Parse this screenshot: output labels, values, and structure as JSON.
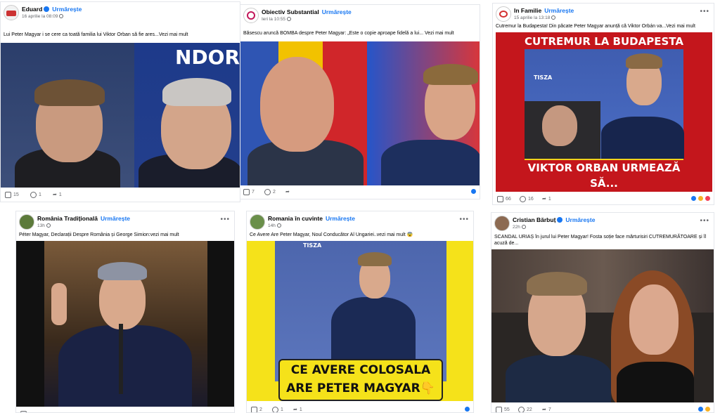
{
  "posts": [
    {
      "author": "Eduard",
      "follow": "Urmărește",
      "time": "16 aprilie la 08:09",
      "caption": "Lui Peter Magyar i se cere ca toată familia lui Viktor Orban să fie ares...Vezi mai mult",
      "image_text": "NDOR",
      "likes": "15",
      "comments": "1",
      "shares": "1"
    },
    {
      "author": "Obiectiv Substantial",
      "follow": "Urmărește",
      "time": "Ieri la 10:55",
      "caption": "Băsescu aruncă BOMBA despre Peter Magyar: „Este o copie aproape fidelă a lui... Vezi mai mult",
      "likes": "7",
      "comments": "2",
      "shares": ""
    },
    {
      "author": "In Familie",
      "follow": "Urmărește",
      "time": "15 aprilie la 13:18",
      "caption": "Cutremur la Budapesta! Din păcate Peter Magyar anunță că Viktor Orbán va...Vezi mai mult",
      "banner_top": "CUTREMUR LA BUDAPESTA",
      "banner_bottom_1": "VIKTOR ORBAN URMEAZĂ",
      "banner_bottom_2": "SĂ...",
      "tisza": "TISZA",
      "likes": "66",
      "comments": "16",
      "shares": "1"
    },
    {
      "author": "România Tradițională",
      "follow": "Urmărește",
      "time": "13h",
      "caption": "Péter Magyar, Declarații Despre România și George Simion:vezi mai mult",
      "likes": "",
      "comments": "",
      "shares": ""
    },
    {
      "author": "Romania în cuvinte",
      "follow": "Urmărește",
      "time": "14h",
      "caption": "Ce Avere Are Peter Magyar, Noul Conducător Al Ungariei..vezi mai mult 😨",
      "overlay_1": "CE AVERE COLOSALA",
      "overlay_2": "ARE PETER MAGYAR",
      "overlay_emoji": "👇",
      "tisza": "TISZA",
      "likes": "2",
      "comments": "1",
      "shares": "1"
    },
    {
      "author": "Cristian Bărbuț",
      "follow": "Urmărește",
      "time": "22h",
      "caption": "SCANDAL URIAȘ în jurul lui Peter Magyar! Fosta soție face mărturisiri CUTREMURĂTOARE și îl acuză de...",
      "likes": "55",
      "comments": "22",
      "shares": "7"
    }
  ],
  "colors": {
    "accent": "#1877f2",
    "banner_red": "#c4161c",
    "overlay_yellow": "#f5e21a"
  }
}
